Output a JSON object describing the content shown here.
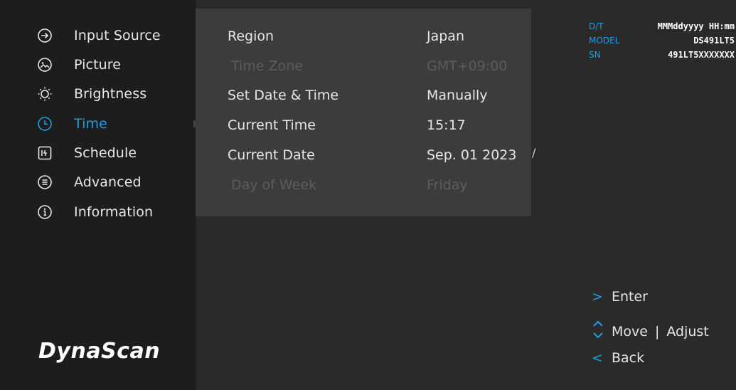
{
  "sidebar": {
    "items": [
      {
        "label": "Input Source",
        "icon": "input-source-icon"
      },
      {
        "label": "Picture",
        "icon": "picture-icon"
      },
      {
        "label": "Brightness",
        "icon": "brightness-icon"
      },
      {
        "label": "Time",
        "icon": "clock-icon",
        "active": true
      },
      {
        "label": "Schedule",
        "icon": "schedule-icon"
      },
      {
        "label": "Advanced",
        "icon": "advanced-icon"
      },
      {
        "label": "Information",
        "icon": "info-icon"
      }
    ],
    "logo": "DynaScan"
  },
  "time_panel": {
    "rows": [
      {
        "label": "Region",
        "value": "Japan",
        "enabled": true
      },
      {
        "label": "Time Zone",
        "value": "GMT+09:00",
        "enabled": false
      },
      {
        "label": "Set Date & Time",
        "value": "Manually",
        "enabled": true
      },
      {
        "label": "Current Time",
        "value": "15:17",
        "enabled": true
      },
      {
        "label": "Current Date",
        "value": "Sep. 01 2023",
        "enabled": true
      },
      {
        "label": "Day of Week",
        "value": "Friday",
        "enabled": false
      }
    ],
    "side_mark": "/"
  },
  "device_info": {
    "dt_key": "D/T",
    "dt_val": "MMMddyyyy HH:mm",
    "model_key": "MODEL",
    "model_val": "DS491LT5",
    "sn_key": "SN",
    "sn_val": "491LT5XXXXXXX"
  },
  "hints": {
    "enter_symbol": ">",
    "enter_label": "Enter",
    "move_label": "Move",
    "separator": "|",
    "adjust_label": "Adjust",
    "back_symbol": "<",
    "back_label": "Back"
  },
  "colors": {
    "accent": "#1e9fe0",
    "sidebar_bg": "#1d1d1d",
    "panel_bg": "#3c3c3c",
    "disabled_text": "#5c5c5c"
  }
}
